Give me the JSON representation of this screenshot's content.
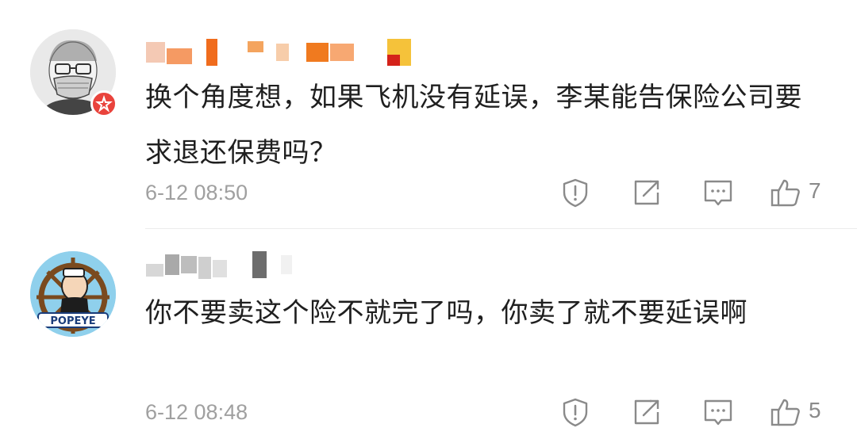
{
  "comments": [
    {
      "text": "换个角度想，如果飞机没有延误，李某能告保险公司要求退还保费吗？",
      "time": "6-12 08:50",
      "likes": "7",
      "avatar": "avatar-sketch-face-mask",
      "verified_badge": "verified-star-badge",
      "username_redacted": true,
      "accent_colors": [
        "#f07a1f",
        "#e84f2e",
        "#f5c23a",
        "#d4221a"
      ]
    },
    {
      "text": "你不要卖这个险不就完了吗，你卖了就不要延误啊",
      "time": "6-12 08:48",
      "likes": "5",
      "avatar": "avatar-popeye",
      "username_redacted": true
    }
  ],
  "icons": {
    "report": "shield-report-icon",
    "share": "share-icon",
    "reply": "comment-icon",
    "like": "thumbs-up-icon"
  }
}
